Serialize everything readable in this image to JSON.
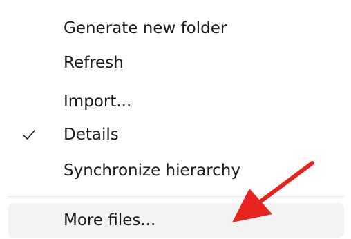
{
  "menu": {
    "items": [
      {
        "label": "Generate new folder",
        "checked": false
      },
      {
        "label": "Refresh",
        "checked": false
      },
      {
        "label": "Import...",
        "checked": false
      },
      {
        "label": "Details",
        "checked": true,
        "icon": "checkmark-icon"
      },
      {
        "label": "Synchronize hierarchy",
        "checked": false
      }
    ],
    "footer_item": {
      "label": "More files...",
      "state": "hovered"
    }
  },
  "annotation": {
    "arrow_icon": "red-arrow-icon",
    "color": "#e8231e"
  }
}
